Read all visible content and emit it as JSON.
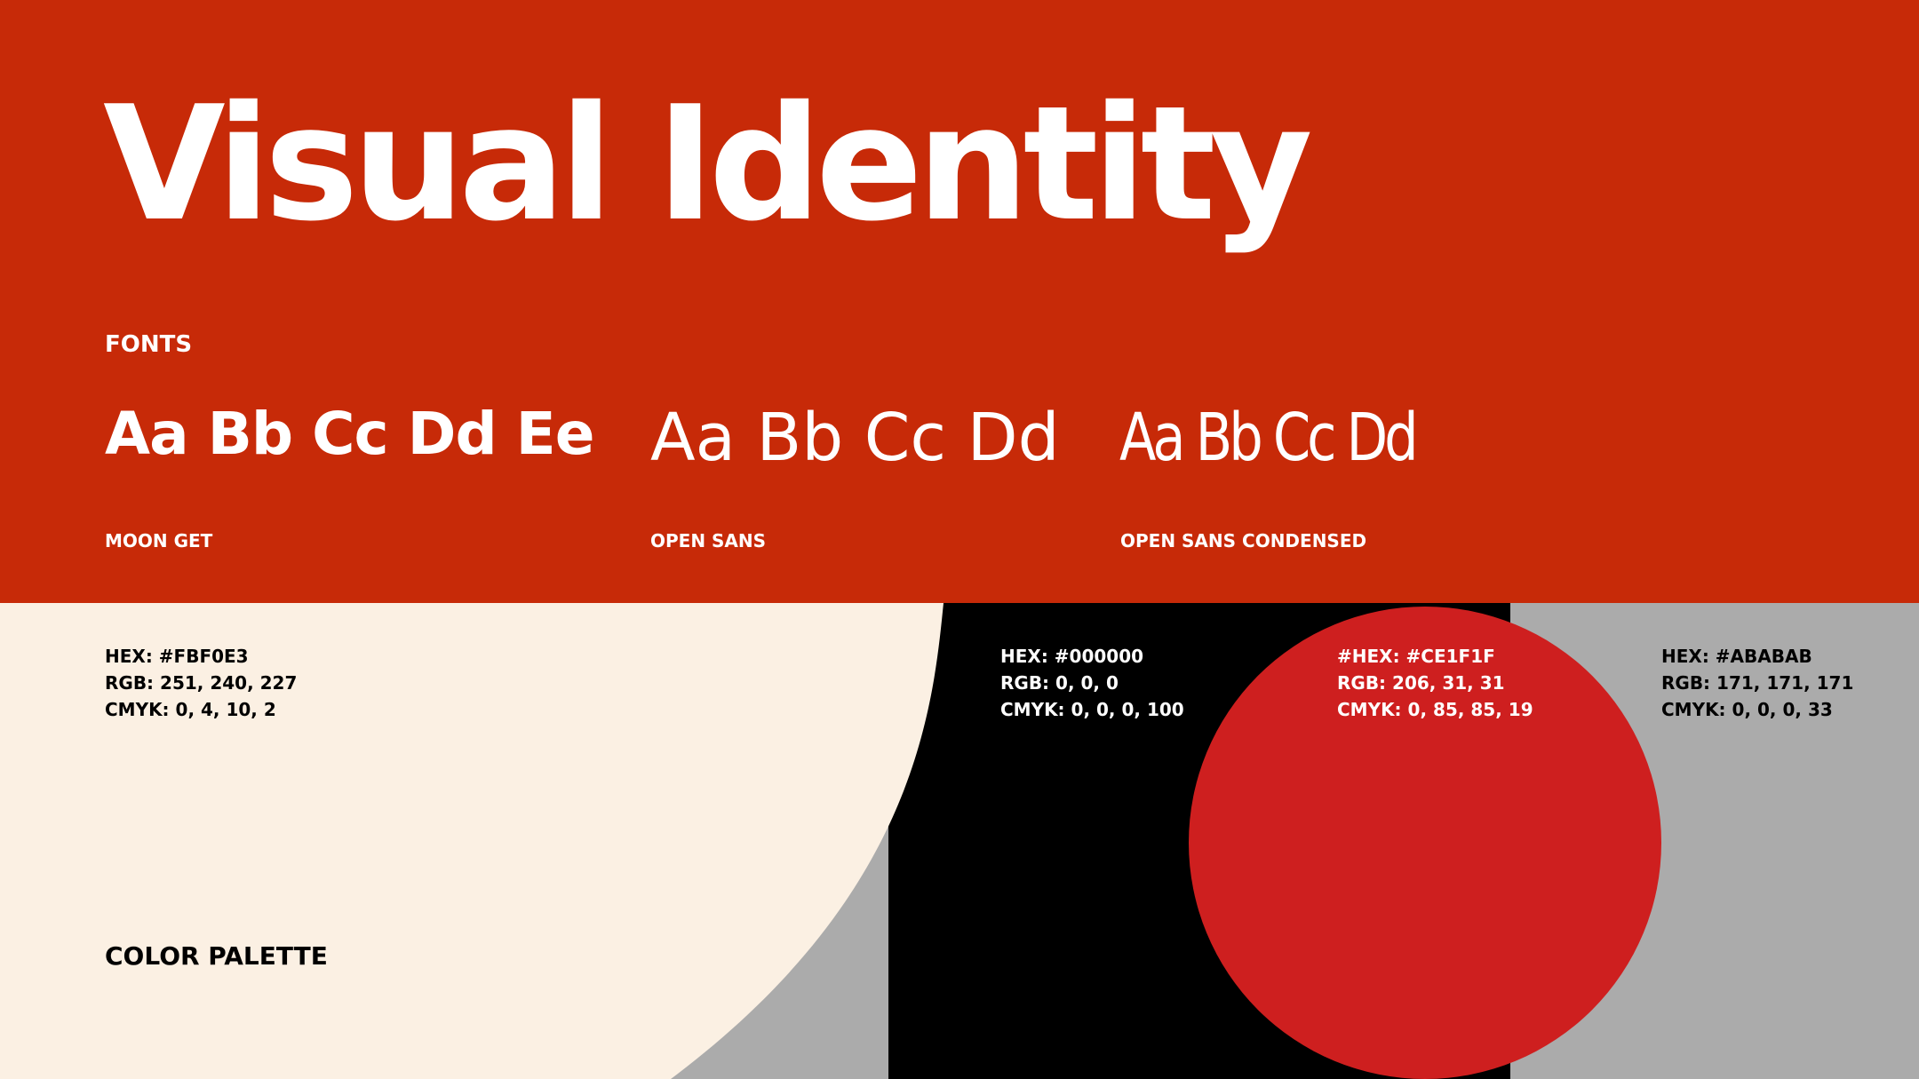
{
  "title": "Visual Identity",
  "fonts_heading": "FONTS",
  "fonts": [
    {
      "sample": "Aa Bb Cc Dd Ee",
      "name": "MOON GET"
    },
    {
      "sample": "Aa Bb Cc Dd",
      "name": "OPEN SANS"
    },
    {
      "sample": "Aa Bb Cc Dd",
      "name": "OPEN SANS CONDENSED"
    }
  ],
  "palette_heading": "COLOR PALETTE",
  "colors": [
    {
      "hex_line": "HEX: #FBF0E3",
      "rgb_line": "RGB: 251, 240, 227",
      "cmyk_line": "CMYK: 0, 4, 10, 2",
      "swatch": "#FBF0E3",
      "text_color": "#000000"
    },
    {
      "hex_line": "HEX: #000000",
      "rgb_line": "RGB: 0, 0, 0",
      "cmyk_line": "CMYK: 0, 0, 0, 100",
      "swatch": "#000000",
      "text_color": "#FFFFFF"
    },
    {
      "hex_line": "#HEX: #CE1F1F",
      "rgb_line": "RGB: 206, 31, 31",
      "cmyk_line": "CMYK: 0, 85, 85, 19",
      "swatch": "#CE1F1F",
      "text_color": "#FFFFFF"
    },
    {
      "hex_line": "HEX: #ABABAB",
      "rgb_line": "RGB: 171, 171, 171",
      "cmyk_line": "CMYK: 0, 0, 0, 33",
      "swatch": "#ABABAB",
      "text_color": "#000000"
    }
  ],
  "header_bg": "#C72A08"
}
